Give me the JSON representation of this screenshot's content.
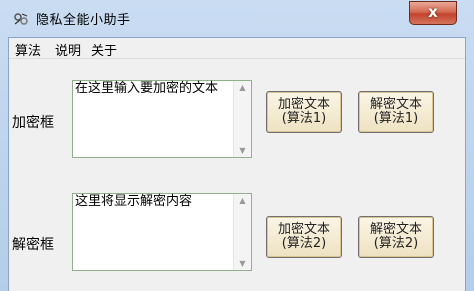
{
  "window": {
    "title": "隐私全能小助手",
    "close_label": "x"
  },
  "menu": {
    "items": [
      "算法",
      "说明",
      "关于"
    ]
  },
  "encrypt": {
    "label": "加密框",
    "text": "在这里输入要加密的文本"
  },
  "decrypt": {
    "label": "解密框",
    "text": "这里将显示解密内容"
  },
  "buttons": {
    "encrypt_alg1": "加密文本\n(算法1)",
    "decrypt_alg1": "解密文本\n(算法1)",
    "encrypt_alg2": "加密文本\n(算法2)",
    "decrypt_alg2": "解密文本\n(算法2)"
  }
}
